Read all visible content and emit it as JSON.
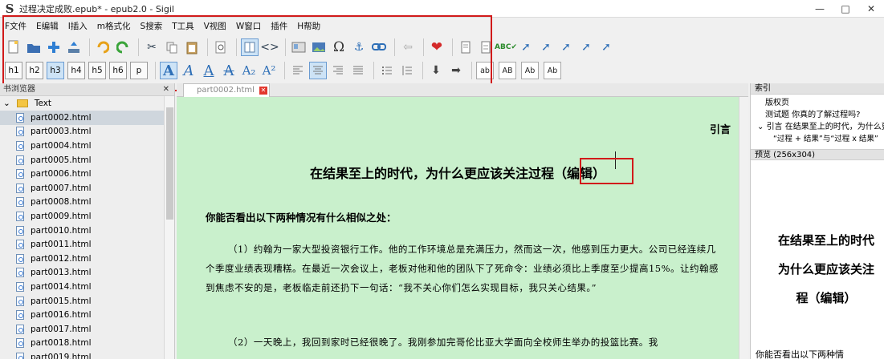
{
  "window": {
    "title": "过程决定成败.epub* - epub2.0 - Sigil",
    "app_icon": "S",
    "controls": [
      "—",
      "□",
      "✕"
    ]
  },
  "menu": [
    "F文件",
    "E编辑",
    "I插入",
    "m格式化",
    "S搜索",
    "T工具",
    "V视图",
    "W窗口",
    "插件",
    "H帮助"
  ],
  "toolbar": {
    "heading_buttons": [
      "h1",
      "h2",
      "h3",
      "h4",
      "h5",
      "h6",
      "p"
    ],
    "font_buttons": [
      "A",
      "A",
      "A",
      "A",
      "A₂",
      "A²"
    ],
    "case_buttons": [
      "ab",
      "AB",
      "Ab",
      "Ab"
    ],
    "symbols": {
      "omega": "Ω",
      "code": "<>",
      "anchor": "⚓"
    }
  },
  "book_browser": {
    "header": "书浏览器",
    "folder": "Text",
    "files": [
      "part0002.html",
      "part0003.html",
      "part0004.html",
      "part0005.html",
      "part0006.html",
      "part0007.html",
      "part0008.html",
      "part0009.html",
      "part0010.html",
      "part0011.html",
      "part0012.html",
      "part0013.html",
      "part0014.html",
      "part0015.html",
      "part0016.html",
      "part0017.html",
      "part0018.html",
      "part0019.html"
    ]
  },
  "editor": {
    "tab_label": "part0002.html",
    "intro": "引言",
    "chapter_title": "在结果至上的时代，为什么更应该关注过程（编辑）",
    "subheading": "你能否看出以下两种情况有什么相似之处：",
    "paragraph1": "（1）约翰为一家大型投资银行工作。他的工作环境总是充满压力，然而这一次，他感到压力更大。公司已经连续几个季度业绩表现糟糕。在最近一次会议上，老板对他和他的团队下了死命令：业绩必须比上季度至少提高15%。让约翰感到焦虑不安的是，老板临走前还扔下一句话：“我不关心你们怎么实现目标，我只关心结果。”",
    "paragraph2": "（2）一天晚上，我回到家时已经很晚了。我刚参加完哥伦比亚大学面向全校师生举办的投篮比赛。我"
  },
  "toc": {
    "header": "索引",
    "items": [
      "版权页",
      "测试题 你真的了解过程吗?",
      "引言 在结果至上的时代，为什么更",
      "“过程 + 结果”与“过程 x 结果”"
    ]
  },
  "preview": {
    "header": "预览 (256x304)",
    "title_lines": [
      "在结果至上的时代",
      "为什么更应该关注",
      "程（编辑）"
    ],
    "text": "你能否看出以下两种情"
  }
}
